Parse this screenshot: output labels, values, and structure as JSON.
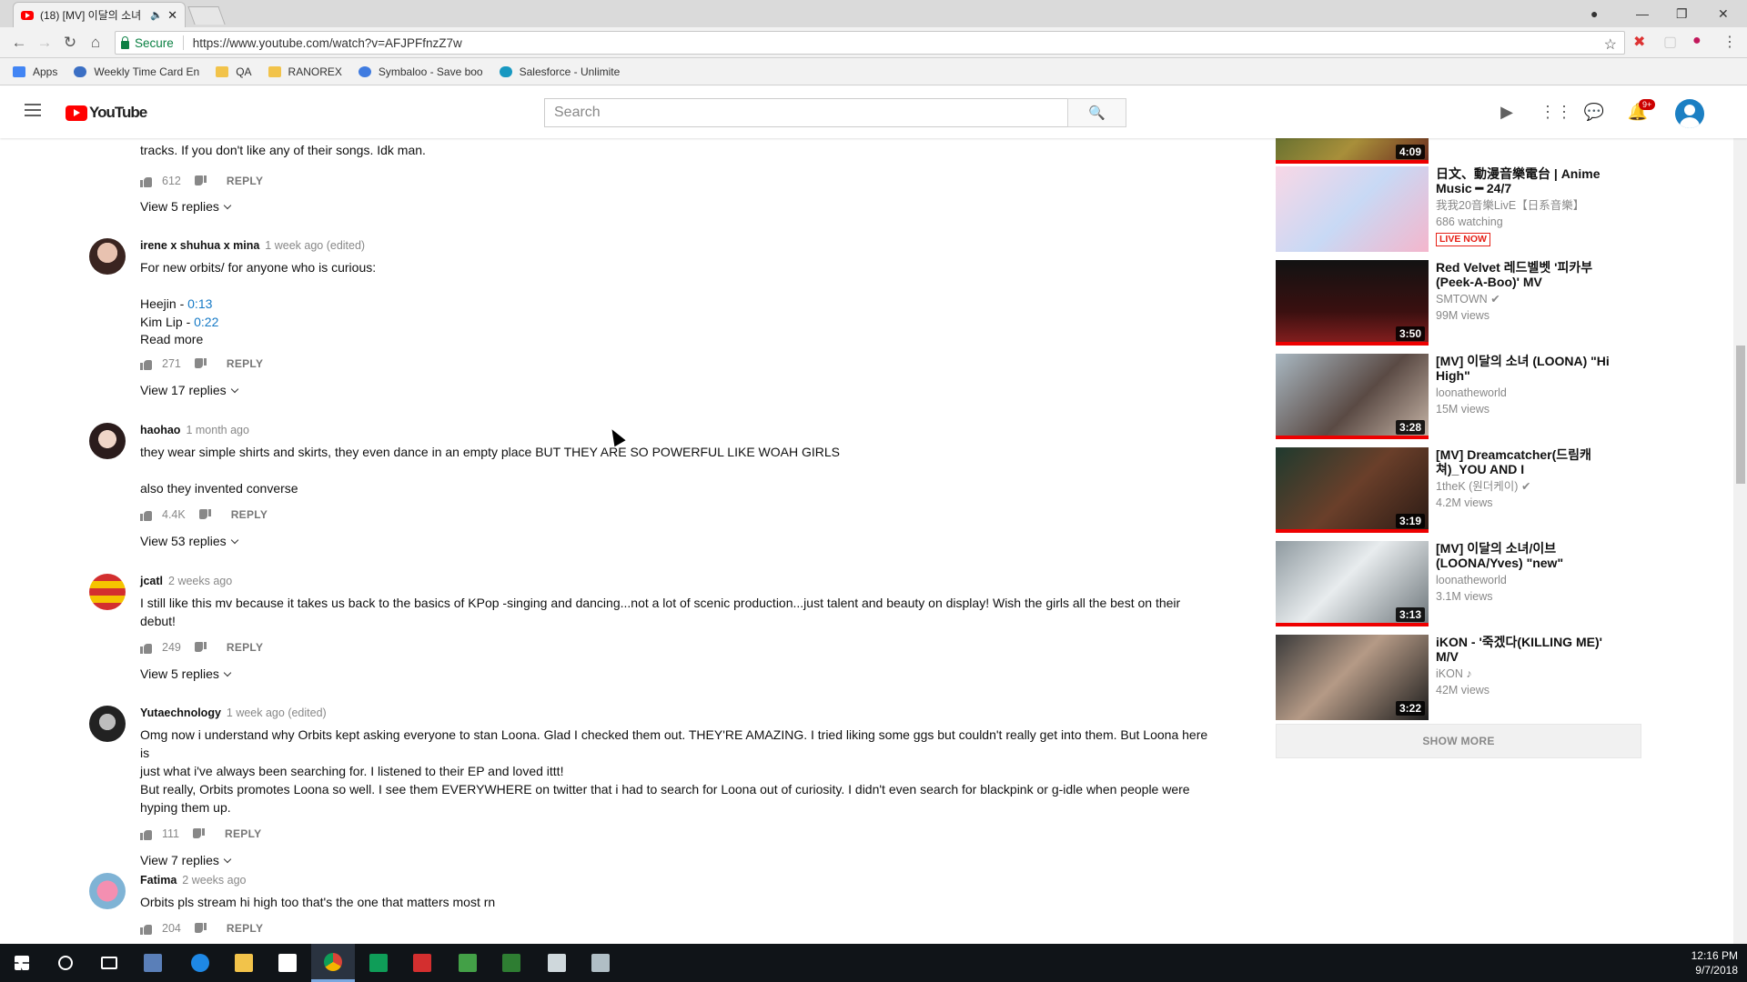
{
  "browser": {
    "tab_title": "(18) [MV] 이달의 소녀",
    "url_secure_label": "Secure",
    "url": "https://www.youtube.com/watch?v=AFJPFfnzZ7w",
    "bookmarks": [
      {
        "label": "Apps",
        "color": "#4285f4"
      },
      {
        "label": "Weekly Time Card En",
        "color": "#3b6fc4"
      },
      {
        "label": "QA",
        "color": "#f2c34a"
      },
      {
        "label": "RANOREX",
        "color": "#f2c34a"
      },
      {
        "label": "Symbaloo - Save boo",
        "color": "#3f7be0"
      },
      {
        "label": "Salesforce - Unlimite",
        "color": "#1798c1"
      }
    ]
  },
  "youtube": {
    "logo_text": "YouTube",
    "search_placeholder": "Search",
    "notif_count": "9+"
  },
  "comments_fragment": {
    "line1": "... ",
    "line2": "tracks. If you don't like any of their songs. Idk man.",
    "likes": "612",
    "reply_label": "REPLY",
    "view_replies": "View 5 replies"
  },
  "comments": [
    {
      "author": "irene x shuhua x mina",
      "time": "1 week ago (edited)",
      "lines": [
        "For new orbits/ for anyone who is curious:",
        "",
        "Heejin - ",
        "Kim Lip - "
      ],
      "ts1": "0:13",
      "ts2": "0:22",
      "read_more": "Read more",
      "likes": "271",
      "reply_label": "REPLY",
      "view_replies": "View 17 replies"
    },
    {
      "author": "haohao",
      "time": "1 month ago",
      "line1": "they wear simple shirts and skirts, they even dance in an empty place BUT THEY ARE SO POWERFUL LIKE WOAH GIRLS",
      "line2": "also they invented converse",
      "likes": "4.4K",
      "reply_label": "REPLY",
      "view_replies": "View 53 replies"
    },
    {
      "author": "jcatl",
      "time": "2 weeks ago",
      "line1": "I still like this mv because it takes us back to the basics of KPop -singing and dancing...not a lot of scenic production...just talent and beauty on display!  Wish the girls all the best on their",
      "line2": "debut!",
      "likes": "249",
      "reply_label": "REPLY",
      "view_replies": "View 5 replies"
    },
    {
      "author": "Yutaechnology",
      "time": "1 week ago (edited)",
      "line1": "Omg now i understand why Orbits kept asking everyone to stan Loona. Glad I checked them out. THEY'RE AMAZING. I tried liking some ggs but couldn't really get into them. But Loona here is",
      "line2": "just what i've always been searching for. I listened to their EP and loved ittt!",
      "line3": "But really, Orbits promotes Loona so well. I see them EVERYWHERE on twitter that i had to search for Loona out of curiosity. I didn't even search for blackpink or g-idle when people were",
      "line4": "hyping them up.",
      "likes": "111",
      "reply_label": "REPLY",
      "view_replies": "View 7 replies"
    },
    {
      "author": "Fatima",
      "time": "2 weeks ago",
      "line1": "Orbits pls stream hi high too that's the one that matters most rn",
      "likes": "204",
      "reply_label": "REPLY"
    }
  ],
  "recommendations": [
    {
      "title": "",
      "channel": "",
      "views": "",
      "duration": "4:09",
      "progress": 1.0
    },
    {
      "title": "日文、動漫音樂電台 | Anime Music ━ 24/7",
      "channel": "我我20音樂LivE【日系音樂】",
      "views": "686 watching",
      "duration": "",
      "live_label": "LIVE NOW",
      "progress": 0
    },
    {
      "title": "Red Velvet 레드벨벳 '피카부 (Peek-A-Boo)' MV",
      "channel": "SMTOWN",
      "views": "99M views",
      "duration": "3:50",
      "progress": 1.0
    },
    {
      "title": "[MV] 이달의 소녀 (LOONA) \"Hi High\"",
      "channel": "loonatheworld",
      "views": "15M views",
      "duration": "3:28",
      "progress": 1.0
    },
    {
      "title": "[MV] Dreamcatcher(드림캐쳐)_YOU AND I",
      "channel": "1theK (원더케이)",
      "views": "4.2M views",
      "duration": "3:19",
      "progress": 1.0
    },
    {
      "title": "[MV] 이달의 소녀/이브 (LOONA/Yves) \"new\"",
      "channel": "loonatheworld",
      "views": "3.1M views",
      "duration": "3:13",
      "progress": 1.0
    },
    {
      "title": "iKON - '죽겠다(KILLING ME)' M/V",
      "channel": "iKON",
      "views": "42M views",
      "duration": "3:22",
      "progress": 1.0
    }
  ],
  "show_more_label": "SHOW MORE",
  "taskbar": {
    "time": "12:16 PM",
    "date": "9/7/2018"
  },
  "colors": {
    "accent_red": "#ff0000",
    "link_blue": "#167ac6"
  }
}
